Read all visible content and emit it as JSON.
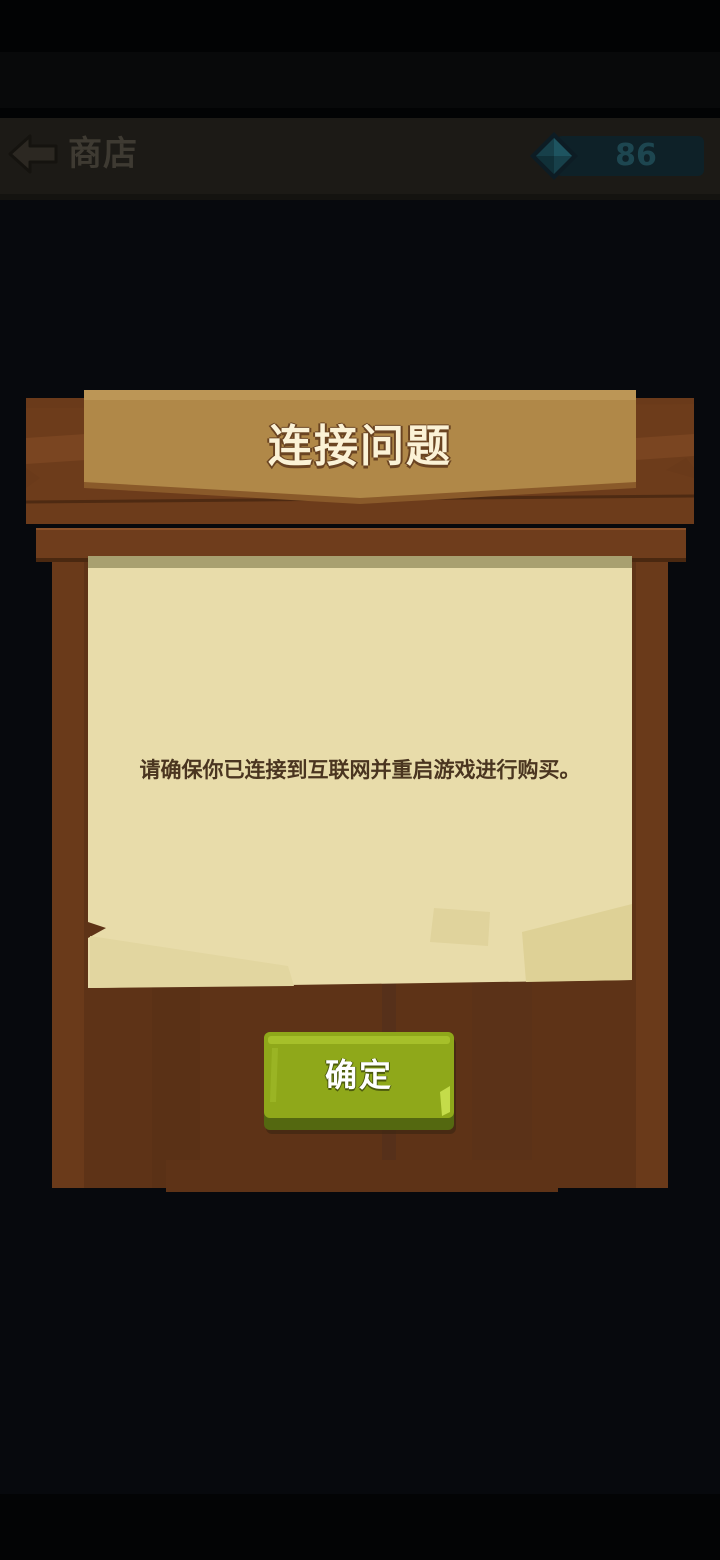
{
  "header": {
    "title": "商店",
    "gem_count": "86",
    "back_icon": "back-arrow-icon",
    "gem_icon": "gem-icon"
  },
  "dialog": {
    "title": "连接问题",
    "message": "请确保你已连接到互联网并重启游戏进行购买。",
    "confirm_label": "确定"
  },
  "colors": {
    "wood_dark": "#5e3317",
    "wood_title": "#b08848",
    "paper": "#e8dcaa",
    "button_green": "#8fa81a",
    "overlay": "#07090d"
  }
}
